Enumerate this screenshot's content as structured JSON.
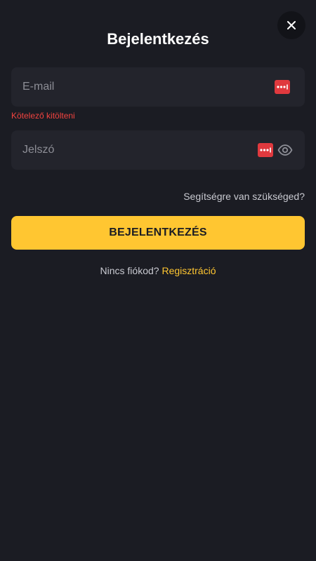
{
  "header": {
    "title": "Bejelentkezés",
    "close_icon": "close-icon"
  },
  "email_field": {
    "placeholder": "E-mail",
    "value": "",
    "error": "Kötelező kitölteni",
    "password_manager_icon": "password-manager-icon"
  },
  "password_field": {
    "placeholder": "Jelszó",
    "value": "",
    "password_manager_icon": "password-manager-icon",
    "visibility_icon": "eye-icon"
  },
  "help_link": "Segítségre van szükséged?",
  "login_button": "BEJELENTKEZÉS",
  "register": {
    "question": "Nincs fiókod?",
    "link": "Regisztráció"
  },
  "colors": {
    "background": "#1b1c23",
    "field_background": "#23242c",
    "accent": "#ffc631",
    "error": "#f2433f",
    "password_manager": "#e0393e"
  }
}
